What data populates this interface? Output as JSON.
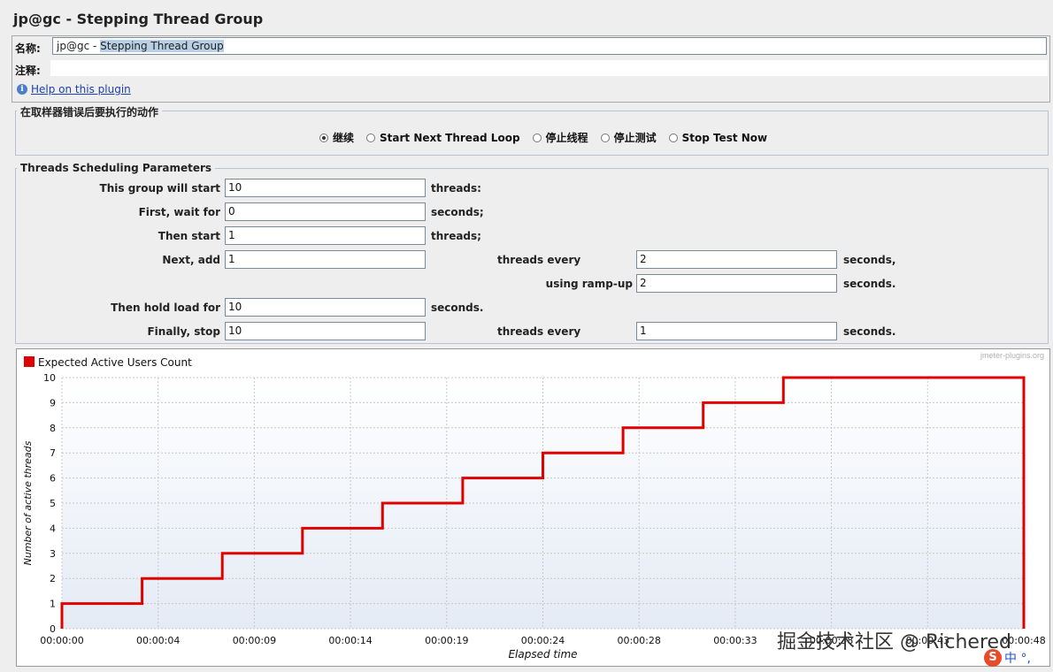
{
  "window": {
    "title": "jp@gc - Stepping Thread Group"
  },
  "name_row": {
    "label": "名称:",
    "value_prefix": "jp@gc - ",
    "value_selected": "Stepping Thread Group"
  },
  "comment_row": {
    "label": "注释:",
    "value": ""
  },
  "help": {
    "icon": "info-icon",
    "link": "Help on this plugin"
  },
  "error_action": {
    "legend": "在取样器错误后要执行的动作",
    "options": [
      {
        "label": "继续",
        "selected": true
      },
      {
        "label": "Start Next Thread Loop",
        "selected": false
      },
      {
        "label": "停止线程",
        "selected": false
      },
      {
        "label": "停止测试",
        "selected": false
      },
      {
        "label": "Stop Test Now",
        "selected": false
      }
    ]
  },
  "params": {
    "legend": "Threads Scheduling Parameters",
    "rows": [
      {
        "label": "This group will start",
        "value": "10",
        "unit": "threads:"
      },
      {
        "label": "First, wait for",
        "value": "0",
        "unit": "seconds;"
      },
      {
        "label": "Then start",
        "value": "1",
        "unit": "threads;"
      },
      {
        "label": "Next, add",
        "value": "1",
        "mid_label": "threads every",
        "value2": "2",
        "unit": "seconds,"
      },
      {
        "label": "using ramp-up",
        "value": "2",
        "unit": "seconds."
      },
      {
        "label": "Then hold load for",
        "value": "10",
        "unit": "seconds."
      },
      {
        "label": "Finally, stop",
        "value": "10",
        "mid_label": "threads every",
        "value2": "1",
        "unit": "seconds."
      }
    ]
  },
  "chart": {
    "brand": "jmeter-plugins.org",
    "legend_label": "Expected Active Users Count",
    "legend_color": "#e00000"
  },
  "chart_data": {
    "type": "line",
    "title": "",
    "xlabel": "Elapsed time",
    "ylabel": "Number of active threads",
    "ylim": [
      0,
      10
    ],
    "x_ticks": [
      "00:00:00",
      "00:00:04",
      "00:00:09",
      "00:00:14",
      "00:00:19",
      "00:00:24",
      "00:00:28",
      "00:00:33",
      "00:00:38",
      "00:00:43",
      "00:00:48"
    ],
    "y_ticks": [
      0,
      1,
      2,
      3,
      4,
      5,
      6,
      7,
      8,
      9,
      10
    ],
    "grid": true,
    "legend_position": "top-left",
    "series": [
      {
        "name": "Expected Active Users Count",
        "color": "#e00000",
        "x_seconds": [
          0,
          0,
          4,
          4,
          8,
          8,
          12,
          12,
          16,
          16,
          20,
          20,
          24,
          24,
          28,
          28,
          32,
          32,
          36,
          36,
          48,
          48
        ],
        "y": [
          0,
          1,
          1,
          2,
          2,
          3,
          3,
          4,
          4,
          5,
          5,
          6,
          6,
          7,
          7,
          8,
          8,
          9,
          9,
          10,
          10,
          0
        ]
      }
    ]
  },
  "overlay": {
    "watermark": "掘金技术社区 @ Richered",
    "ime_text": "中 °,"
  }
}
